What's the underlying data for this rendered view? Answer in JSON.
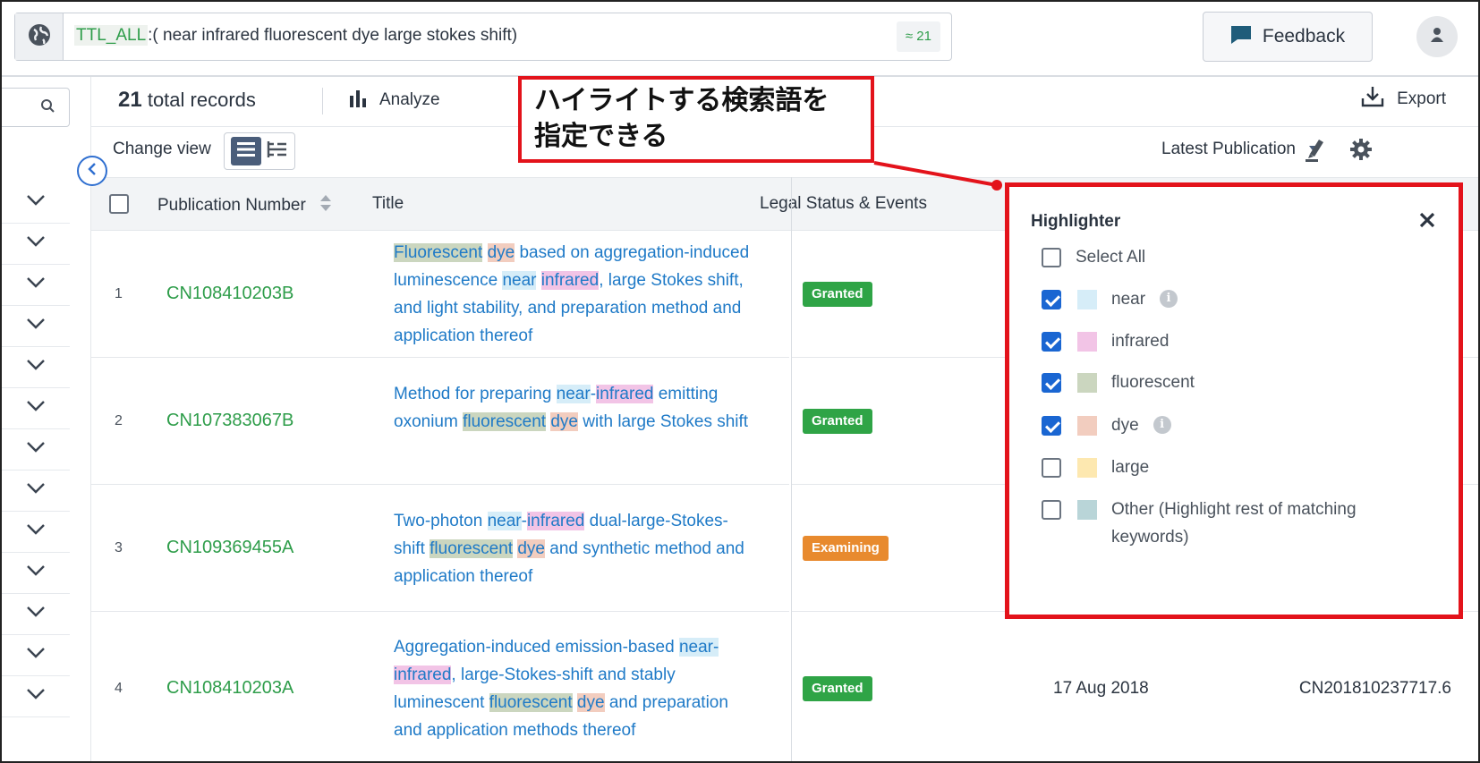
{
  "search": {
    "field": "TTL_ALL",
    "query": ":( near infrared fluorescent dye large stokes shift)",
    "hits": "≈ 21"
  },
  "header": {
    "feedback_label": "Feedback"
  },
  "toolbar": {
    "count": "21",
    "total_label": "total records",
    "analyze_label": "Analyze",
    "export_label": "Export",
    "change_view_label": "Change view",
    "sort_label": "Latest Publication"
  },
  "table": {
    "headers": {
      "pubno": "Publication Number",
      "title": "Title",
      "legal": "Legal Status & Events"
    },
    "rows": [
      {
        "num": "1",
        "pubno": "CN108410203B",
        "title": [
          {
            "t": "Fluorescent",
            "h": "fluor"
          },
          {
            "t": " "
          },
          {
            "t": "dye",
            "h": "dye"
          },
          {
            "t": " based on aggregation-induced luminescence "
          },
          {
            "t": "near",
            "h": "near"
          },
          {
            "t": " "
          },
          {
            "t": "infrared",
            "h": "infrared"
          },
          {
            "t": ", large Stokes shift, and light stability, and preparation method and application thereof"
          }
        ],
        "status": "Granted",
        "status_type": "granted"
      },
      {
        "num": "2",
        "pubno": "CN107383067B",
        "title": [
          {
            "t": "Method for preparing "
          },
          {
            "t": "near",
            "h": "near"
          },
          {
            "t": "-"
          },
          {
            "t": "infrared",
            "h": "infrared"
          },
          {
            "t": " emitting oxonium "
          },
          {
            "t": "fluorescent",
            "h": "fluor"
          },
          {
            "t": " "
          },
          {
            "t": "dye",
            "h": "dye"
          },
          {
            "t": " with large Stokes shift"
          }
        ],
        "status": "Granted",
        "status_type": "granted"
      },
      {
        "num": "3",
        "pubno": "CN109369455A",
        "title": [
          {
            "t": "Two-photon "
          },
          {
            "t": "near",
            "h": "near"
          },
          {
            "t": "-"
          },
          {
            "t": "infrared",
            "h": "infrared"
          },
          {
            "t": " dual-large-Stokes-shift "
          },
          {
            "t": "fluorescent",
            "h": "fluor"
          },
          {
            "t": " "
          },
          {
            "t": "dye",
            "h": "dye"
          },
          {
            "t": " and synthetic method and application thereof"
          }
        ],
        "status": "Examining",
        "status_type": "examining"
      },
      {
        "num": "4",
        "pubno": "CN108410203A",
        "title": [
          {
            "t": "Aggregation-induced emission-based "
          },
          {
            "t": "near-",
            "h": "near"
          },
          {
            "t": "infrared",
            "h": "infrared"
          },
          {
            "t": ", large-Stokes-shift and stably luminescent "
          },
          {
            "t": "fluorescent",
            "h": "fluor"
          },
          {
            "t": " "
          },
          {
            "t": "dye",
            "h": "dye"
          },
          {
            "t": " and preparation and application methods thereof"
          }
        ],
        "status": "Granted",
        "status_type": "granted",
        "date": "17 Aug 2018",
        "appno": "CN201810237717.6"
      }
    ]
  },
  "highlighter": {
    "title": "Highlighter",
    "select_all_label": "Select All",
    "items": [
      {
        "label": "near",
        "checked": true,
        "color": "#d6edf8",
        "info": true
      },
      {
        "label": "infrared",
        "checked": true,
        "color": "#f2c4e6",
        "info": false
      },
      {
        "label": "fluorescent",
        "checked": true,
        "color": "#cbd6bf",
        "info": false
      },
      {
        "label": "dye",
        "checked": true,
        "color": "#f2cdbf",
        "info": true
      },
      {
        "label": "large",
        "checked": false,
        "color": "#fde8b0",
        "info": false
      },
      {
        "label": "Other (Highlight rest of matching keywords)",
        "checked": false,
        "color": "#b9d5d8",
        "info": false
      }
    ]
  },
  "annotation": {
    "line1": "ハイライトする検索語を",
    "line2": "指定できる"
  },
  "colors": {
    "accent": "#1a66d2",
    "link": "#1f7ac7",
    "pub_number": "#2e9d4a",
    "granted": "#2fa446",
    "examining": "#e88a2e",
    "annotation_red": "#e3131b"
  }
}
